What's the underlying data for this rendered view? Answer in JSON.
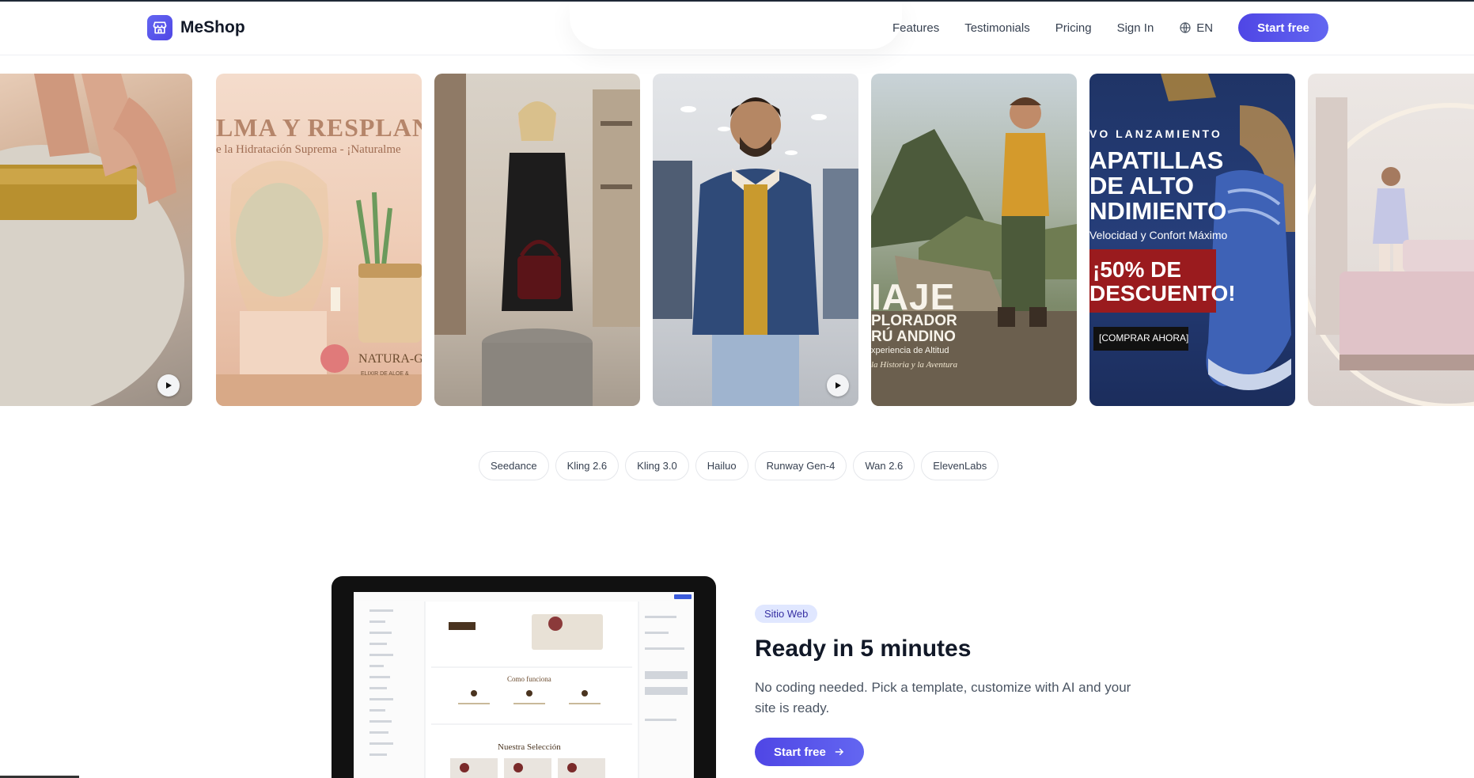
{
  "header": {
    "brand": "MeShop",
    "nav": [
      "Features",
      "Testimonials",
      "Pricing",
      "Sign In"
    ],
    "language": "EN",
    "cta": "Start free"
  },
  "gallery": {
    "cards": [
      {
        "id": "cream-jar",
        "has_play": true
      },
      {
        "id": "skincare-ad",
        "lines": [
          "LMA Y RESPLAND",
          "e la Hidratación Suprema - ¡Naturalme",
          "NATURA-G",
          "ELIXIR DE ALOE &"
        ]
      },
      {
        "id": "boutique-woman"
      },
      {
        "id": "denim-man",
        "has_play": true
      },
      {
        "id": "travel-ad",
        "lines": [
          "IAJE",
          "PLORADOR",
          "RÚ ANDINO",
          "xperiencia de Altitud",
          "la Historia y la Aventura"
        ]
      },
      {
        "id": "sneaker-ad",
        "lines": [
          "VO LANZAMIENTO",
          "APATILLAS",
          "DE ALTO",
          "NDIMIENTO",
          "Velocidad y Confort Máximo",
          "¡50% DE",
          "DESCUENTO!",
          "[COMPRAR AHORA]"
        ]
      },
      {
        "id": "bedroom"
      }
    ]
  },
  "models": [
    "Seedance",
    "Kling 2.6",
    "Kling 3.0",
    "Hailuo",
    "Runway Gen-4",
    "Wan 2.6",
    "ElevenLabs"
  ],
  "feature": {
    "badge": "Sitio Web",
    "title": "Ready in 5 minutes",
    "description": "No coding needed. Pick a template, customize with AI and your site is ready.",
    "cta": "Start free",
    "preview": {
      "heading1": "Como funciona",
      "heading2": "Nuestra Selección"
    }
  }
}
